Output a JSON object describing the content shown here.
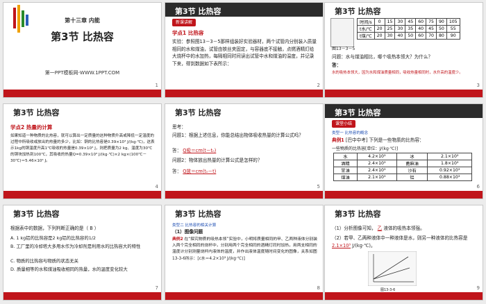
{
  "slides": [
    {
      "num": "1",
      "chapter": "第十三章 内能",
      "title": "第3节   比热容",
      "footer": "第一PPT模板网-WWW.1PPT.COM"
    },
    {
      "num": "2",
      "header": "第3节   比热容",
      "tag": "新课讲解",
      "section": "学点1  比热容",
      "text": "实验：参照图13－3－5那样组装好实验器材，两个试管内分别装入质量相同的水和煤油，试管由铁丝夹固定，与容器底不接触，点燃酒精灯给大烧杯中的水加热，每隔相同时间读出试管中水和煤油的温度，并记录下来，得到数据如下表所示："
    },
    {
      "num": "3",
      "header": "第3节   比热容",
      "table": {
        "rows": [
          [
            "时间/s",
            "0",
            "15",
            "30",
            "45",
            "60",
            "75",
            "90",
            "105"
          ],
          [
            "t水/℃",
            "20",
            "25",
            "30",
            "35",
            "40",
            "45",
            "50",
            "55"
          ],
          [
            "t煤/℃",
            "20",
            "30",
            "40",
            "50",
            "60",
            "70",
            "80",
            "90"
          ]
        ]
      },
      "figure_label": "图13－3－5",
      "question": "问题：水与煤油相比，哪个吸热本领大？为什么？",
      "answer_label": "答：",
      "answer": "水的吸热本领大，因为水和煤油质量相同，吸收热量相同时，水升高的温度少。"
    },
    {
      "num": "4",
      "header": "第3节   比热容",
      "section": "学点2  热量的计算",
      "text": "如果知道一种物质的比热容，就可以算出一定质量的这种物质升高或降低一定温度的过程中所吸收或放出的热量的多少，比如：铜的比热容是0.39×10³ J/(kg·℃)，这表示1kg的铜温度升高1℃吸收的热量是0.39×10³ J，则把质量为2 kg、温度为30℃的铜块加热到100℃，其吸收的热量Q=0.39×10³ J/(kg·℃)×2 kg×(100℃－30℃)＝5.46×10⁴ J。"
    },
    {
      "num": "5",
      "header": "第3节   比热容",
      "think": "思考：",
      "q1": "问题1：根据上述信息，你能总结出物体吸收热量的计算公式吗？",
      "a1_label": "答：",
      "a1": "Q吸＝cm(t－t₀)",
      "q2": "问题2：物体放出热量的计算公式是怎样的？",
      "a2_label": "答：",
      "a2": "Q放＝cm(t₀－t)"
    },
    {
      "num": "6",
      "header": "第3节   比热容",
      "tag": "课堂小结",
      "type_label": "类型一  比热容的概念",
      "example": "典例1",
      "example_text": "[巴中中考] 下列是一些物质的比热容：",
      "table": {
        "caption": "一些物质的比热容[单位：J/(kg·℃)]",
        "rows": [
          [
            "水",
            "4.2×10³",
            "冰",
            "2.1×10³"
          ],
          [
            "酒精",
            "2.4×10³",
            "蓖麻油",
            "1.8×10³"
          ],
          [
            "甘油",
            "2.4×10³",
            "沙石",
            "0.92×10³"
          ],
          [
            "煤油",
            "2.1×10³",
            "铝",
            "0.88×10³"
          ]
        ]
      }
    },
    {
      "num": "7",
      "header": "第3节   比热容",
      "question": "根据表中的数据，下列判断正确的是（ B ）",
      "options": [
        "A. 1 kg铝的比热容是2 kg铝的比热容的1/2",
        "B. 工厂里的冷却塔大多用水作为冷却剂是利用水的比热容大的特性",
        "C. 物质的比热容与物质的状态无关",
        "D. 质量相等的水和煤油吸收相同的热量，水的温度变化较大"
      ]
    },
    {
      "num": "8",
      "header": "第3节   比热容",
      "type_label": "类型二  比热容的相关计算",
      "sub": "（1）图像问题",
      "example": "典例2",
      "example_text": "在“探究物质的吸热本领”实验中，小明将质量相同的甲、乙两种液体分别装入两个完全相同的烧杯中，分别用两个完全相同的酒精灯同时加热，用两支相同的温度计分别测量烧杯内液体的温度，并作出液体温度随时间变化的图像，关系如图13-3-6所示：[c水＝4.2×10³ J/(kg·℃)]"
    },
    {
      "num": "9",
      "header": "第3节   比热容",
      "q1": "（1）分析图像可知，",
      "a1": "乙",
      "q1b": "液体的吸热本领强。",
      "q2": "（2）若甲、乙两种液体中一种液体是水，则另一种液体的比热容是",
      "a2": "2.1×10³",
      "q2b": "J/(kg·℃)。",
      "fig_label": "图13-3-6"
    }
  ],
  "colors": {
    "red": "#c0151b",
    "dark": "#2b2b2b",
    "blue": "#1f4fb3"
  }
}
